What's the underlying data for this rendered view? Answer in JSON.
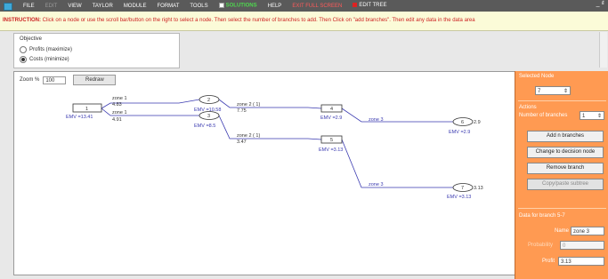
{
  "menu": {
    "items": [
      "FILE",
      "EDIT",
      "VIEW",
      "TAYLOR",
      "MODULE",
      "FORMAT",
      "TOOLS"
    ],
    "solutions": "SOLUTIONS",
    "help": "HELP",
    "exit_full": "EXIT FULL SCREEN",
    "edit_tree": "EDIT TREE",
    "window_controls": "_ ₫"
  },
  "instruction": {
    "label": "INSTRUCTION:",
    "text": "Click on a node or use the scroll bar/button on the right to select a node. Then select the number of branches to add. Then Click on \"add branches\". Then edit any data in the data area"
  },
  "objective": {
    "title": "Objective",
    "options": [
      "Profits (maximize)",
      "Costs (minimize)"
    ],
    "selected": 1
  },
  "canvas": {
    "zoom_label": "Zoom %",
    "zoom_value": "100",
    "redraw": "Redraw"
  },
  "tree": {
    "nodes": [
      {
        "id": "1",
        "shape": "decision",
        "emv": "EMV =13.41"
      },
      {
        "id": "2",
        "shape": "chance",
        "emv": "EMV =10.58"
      },
      {
        "id": "3",
        "shape": "chance",
        "emv": "EMV =8.5"
      },
      {
        "id": "4",
        "shape": "decision",
        "emv": "EMV =2.9"
      },
      {
        "id": "5",
        "shape": "decision",
        "emv": "EMV =3.13"
      },
      {
        "id": "6",
        "shape": "chance",
        "emv": "EMV =2.9",
        "terminal": "2.9"
      },
      {
        "id": "7",
        "shape": "chance",
        "emv": "EMV =3.13",
        "terminal": "3.13"
      }
    ],
    "branches": [
      {
        "name": "zone 1",
        "value": "4.83"
      },
      {
        "name": "zone 1",
        "value": "4.91"
      },
      {
        "name": "zone 2 ( 1)",
        "value": "7.75"
      },
      {
        "name": "zone 2 ( 1)",
        "value": "3.47"
      },
      {
        "name": "zone 3",
        "value": ""
      },
      {
        "name": "zone 3",
        "value": ""
      }
    ]
  },
  "panel": {
    "selected_node_label": "Selected Node",
    "selected_node_value": "7",
    "actions_label": "Actions",
    "num_branches_label": "Number of branches",
    "num_branches_value": "1",
    "btn_add": "Add n branches",
    "btn_change": "Change to decision node",
    "btn_remove": "Remove branch",
    "btn_copy": "Copy/paste subtree",
    "data_label": "Data for branch 5-7",
    "name_label": "Name",
    "name_value": "zone 3",
    "prob_label": "Probability",
    "prob_value": "0",
    "profit_label": "Profit",
    "profit_value": "3.13"
  },
  "colors": {
    "menubar": "#5a5a5a",
    "panel": "#ff9a52",
    "branch_line": "#3a3ab0",
    "instruction_text": "#cc2222"
  }
}
